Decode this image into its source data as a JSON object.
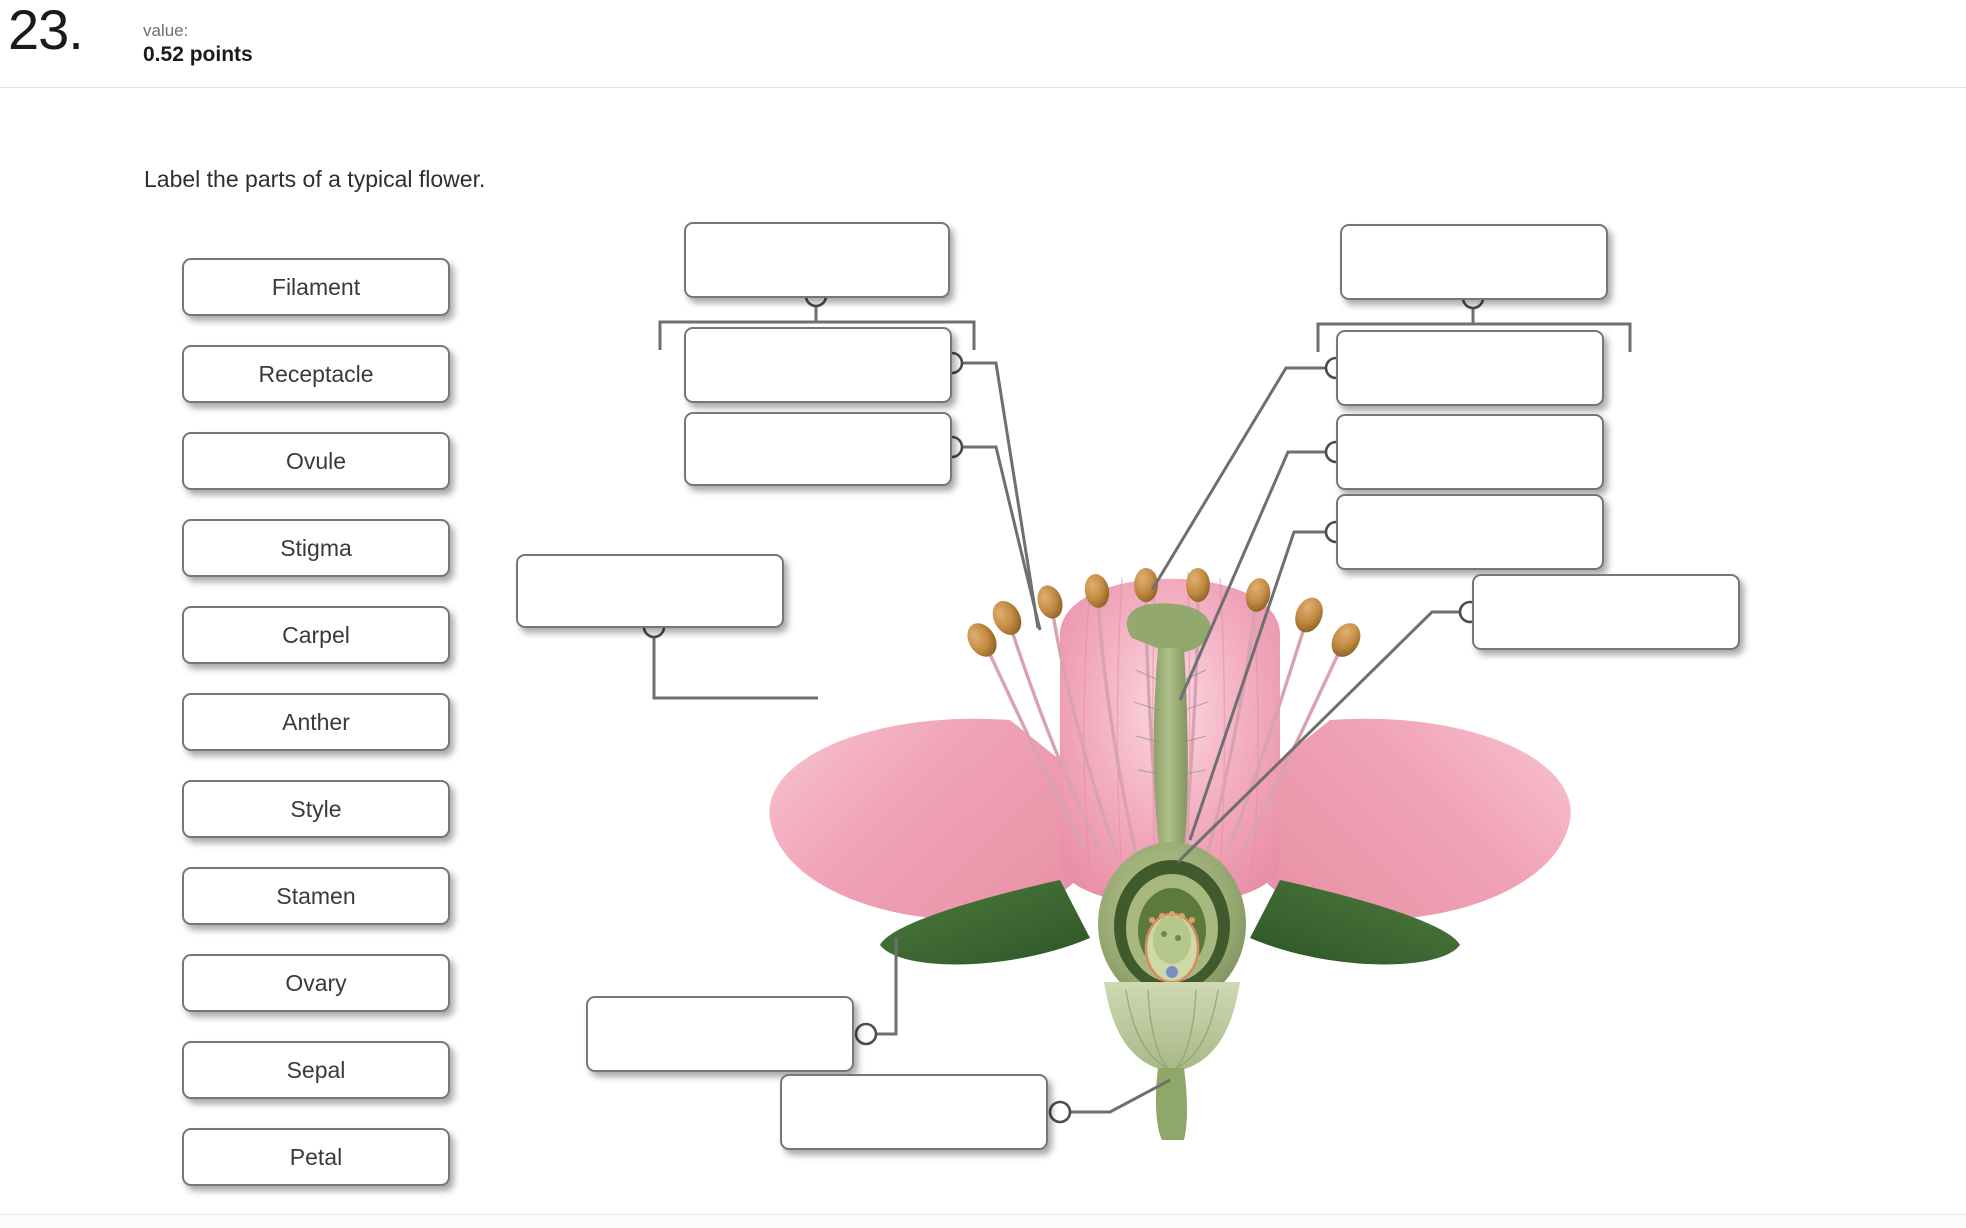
{
  "header": {
    "question_number": "23.",
    "value_label": "value:",
    "value_points": "0.52 points"
  },
  "prompt": "Label the parts of a typical flower.",
  "answer_bank": {
    "items": [
      {
        "label": "Filament"
      },
      {
        "label": "Receptacle"
      },
      {
        "label": "Ovule"
      },
      {
        "label": "Stigma"
      },
      {
        "label": "Carpel"
      },
      {
        "label": "Anther"
      },
      {
        "label": "Style"
      },
      {
        "label": "Stamen"
      },
      {
        "label": "Ovary"
      },
      {
        "label": "Sepal"
      },
      {
        "label": "Petal"
      }
    ]
  },
  "drop_targets": [
    {
      "id": "left-group-title",
      "value": "",
      "placeholder": ""
    },
    {
      "id": "left-upper",
      "value": "",
      "placeholder": ""
    },
    {
      "id": "left-lower",
      "value": "",
      "placeholder": ""
    },
    {
      "id": "left-petal",
      "value": "",
      "placeholder": ""
    },
    {
      "id": "right-group-title",
      "value": "",
      "placeholder": ""
    },
    {
      "id": "right-upper",
      "value": "",
      "placeholder": ""
    },
    {
      "id": "right-middle",
      "value": "",
      "placeholder": ""
    },
    {
      "id": "right-lower",
      "value": "",
      "placeholder": ""
    },
    {
      "id": "far-right",
      "value": "",
      "placeholder": ""
    },
    {
      "id": "bottom-left",
      "value": "",
      "placeholder": ""
    },
    {
      "id": "bottom-center",
      "value": "",
      "placeholder": ""
    }
  ],
  "colors": {
    "card_border": "#77777a",
    "card_background": "#ffffff",
    "connector": "#6f6f72",
    "node_fill": "#ffffff",
    "text": "#3a3a3e",
    "petal_pink": "#f0a0b4",
    "petal_pink_light": "#f7c4d2",
    "stem_green": "#9cb07a",
    "leaf_green": "#3d6b35",
    "anther_tan": "#c08a42"
  }
}
